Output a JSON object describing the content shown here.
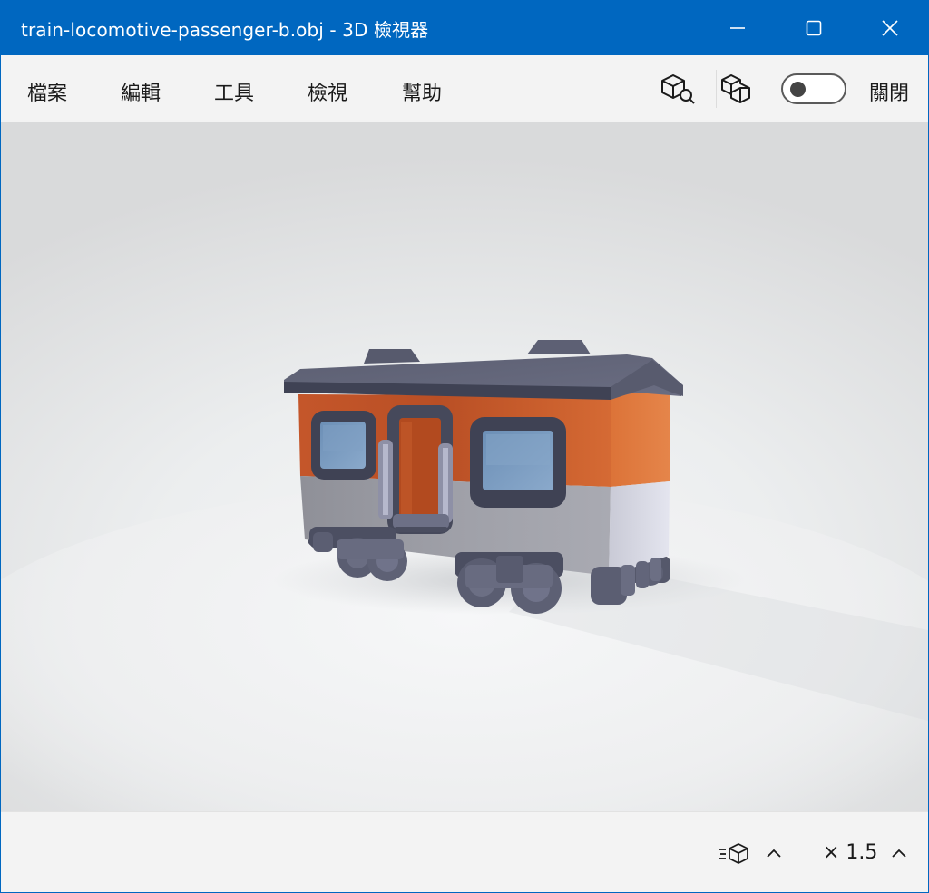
{
  "window": {
    "title": "train-locomotive-passenger-b.obj - 3D 檢視器",
    "accent_color": "#0067c0"
  },
  "menu": {
    "items": [
      {
        "label": "檔案"
      },
      {
        "label": "編輯"
      },
      {
        "label": "工具"
      },
      {
        "label": "檢視"
      },
      {
        "label": "幫助"
      }
    ]
  },
  "toolbar": {
    "inspect_icon": "cube-search-icon",
    "view_icon": "cubes-icon",
    "toggle": {
      "state": "off",
      "label": "關閉"
    }
  },
  "viewport": {
    "model_icon": "passenger-train-car"
  },
  "statusbar": {
    "animation_icon": "cube-speed-icon",
    "zoom_label": "× 1.5"
  }
}
